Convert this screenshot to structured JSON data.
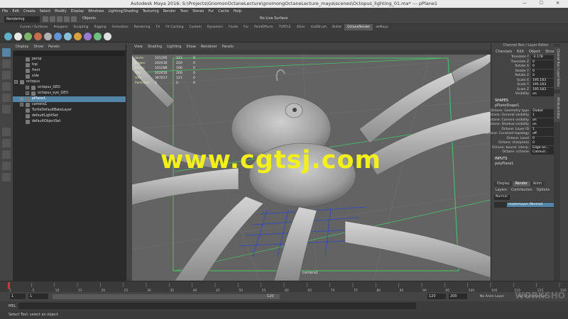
{
  "window": {
    "title": "Autodesk Maya 2016: S:\\Projects\\GnomonOctaneLecture\\gnomongOctaneLecture_maya\\scenes\\Octopus_lighting_01.ma*   ---   pPlane1",
    "controls": "—  ☐  ✕"
  },
  "menubar": [
    "File",
    "Edit",
    "Create",
    "Select",
    "Modify",
    "Display",
    "Windows",
    "Lighting/Shading",
    "Texturing",
    "Render",
    "Toon",
    "Stereo",
    "Fur",
    "Cache",
    "Help"
  ],
  "statusline": {
    "mode": "Rendering",
    "objects": "Objects",
    "live_surface": "No Live Surface"
  },
  "shelf_tabs": [
    "Curves / Surfaces",
    "Polygons",
    "Sculpting",
    "Rigging",
    "Animation",
    "Rendering",
    "FX",
    "FX Caching",
    "Custom",
    "Dynamics",
    "Fluids",
    "Fur",
    "PaintEffects",
    "TURTLE",
    "XGen",
    "GoZBrush",
    "Bullet",
    "OctaneRender",
    "ekMaya"
  ],
  "shelf_active": "OctaneRender",
  "shelf_icon_colors": [
    "#5fb0c8",
    "#e8e8e8",
    "#7fb56a",
    "#c86b4b",
    "#b0b0b0",
    "#5f94d6",
    "#88c0d8",
    "#d8a040",
    "#9a7ad0",
    "#70c080",
    "#e0e0e0"
  ],
  "outliner": {
    "menu": [
      "Display",
      "Show",
      "Panels"
    ],
    "items": [
      {
        "label": "persp",
        "indent": 1,
        "expander": false,
        "selected": false
      },
      {
        "label": "top",
        "indent": 1,
        "expander": false,
        "selected": false
      },
      {
        "label": "front",
        "indent": 1,
        "expander": false,
        "selected": false
      },
      {
        "label": "side",
        "indent": 1,
        "expander": false,
        "selected": false
      },
      {
        "label": "octopus",
        "indent": 0,
        "expander": true,
        "selected": false
      },
      {
        "label": "octopus_GEO",
        "indent": 2,
        "expander": true,
        "selected": false
      },
      {
        "label": "octopus_eye_GEO",
        "indent": 2,
        "expander": true,
        "selected": false
      },
      {
        "label": "pPlane1",
        "indent": 1,
        "expander": true,
        "selected": true
      },
      {
        "label": "camera1",
        "indent": 1,
        "expander": true,
        "selected": false
      },
      {
        "label": "TurtleDefaultBakeLayer",
        "indent": 1,
        "expander": false,
        "selected": false
      },
      {
        "label": "defaultLightSet",
        "indent": 1,
        "expander": false,
        "selected": false
      },
      {
        "label": "defaultObjectSet",
        "indent": 1,
        "expander": false,
        "selected": false
      }
    ]
  },
  "viewport": {
    "menu": [
      "View",
      "Shading",
      "Lighting",
      "Show",
      "Renderer",
      "Panels"
    ],
    "stats": [
      {
        "label": "Verts:",
        "a": "101295",
        "b": "121",
        "c": "0"
      },
      {
        "label": "Edges:",
        "a": "202436",
        "b": "220",
        "c": "0"
      },
      {
        "label": "Faces:",
        "a": "101288",
        "b": "100",
        "c": "0"
      },
      {
        "label": "Tris:",
        "a": "202416",
        "b": "200",
        "c": "0"
      },
      {
        "label": "UVs:",
        "a": "367017",
        "b": "121",
        "c": "0"
      },
      {
        "label": "Particles:",
        "a": "0",
        "b": "0",
        "c": "0"
      }
    ],
    "camera_label": "camera1"
  },
  "watermark": "www.cgtsj.com",
  "channel_box": {
    "title": "Channel Box / Layer Editor",
    "menu": [
      "Channels",
      "Edit",
      "Object",
      "Show"
    ],
    "attributes": [
      {
        "name": "Translate Y",
        "value": "-2.178"
      },
      {
        "name": "Translate Z",
        "value": "0"
      },
      {
        "name": "Rotate X",
        "value": "0"
      },
      {
        "name": "Rotate Y",
        "value": "0"
      },
      {
        "name": "Rotate Z",
        "value": "0"
      },
      {
        "name": "Scale X",
        "value": "195.183"
      },
      {
        "name": "Scale Y",
        "value": "195.183"
      },
      {
        "name": "Scale Z",
        "value": "195.183"
      },
      {
        "name": "Visibility",
        "value": "on"
      }
    ],
    "shapes_header": "SHAPES",
    "shape_name": "pPlaneShape1",
    "shape_attributes": [
      {
        "name": "Octane: Geometry type",
        "value": "Global"
      },
      {
        "name": "Octane: General visibility",
        "value": "1"
      },
      {
        "name": "Octane: Camera visibility",
        "value": "on"
      },
      {
        "name": "Octane: Shadow visibility",
        "value": "on"
      },
      {
        "name": "Octane: Layer ID",
        "value": "1"
      },
      {
        "name": "Octane: Constant topology",
        "value": "off"
      },
      {
        "name": "Octane: Level",
        "value": "0"
      },
      {
        "name": "Octane: sharpness",
        "value": "0"
      },
      {
        "name": "Octane: bound. interp.",
        "value": "Edge an..."
      },
      {
        "name": "Octane: scheme",
        "value": "Catmull..."
      }
    ],
    "inputs_header": "INPUTS",
    "input_name": "polyPlane1",
    "side_tabs": [
      "Channel Box / Layer Editor",
      "Attribute Editor"
    ]
  },
  "layer_editor": {
    "tabs": [
      "Display",
      "Render",
      "Anim"
    ],
    "active_tab": "Render",
    "menu": [
      "Layers",
      "Contribution",
      "Options"
    ],
    "blend": "Normal",
    "layer_name": "masterLayer (Normal)"
  },
  "time_slider": {
    "ticks": [
      "1",
      "5",
      "10",
      "15",
      "20",
      "25",
      "30",
      "35",
      "40",
      "45",
      "50",
      "55",
      "60",
      "65",
      "70",
      "75",
      "80",
      "85",
      "90",
      "95",
      "100",
      "105",
      "110",
      "115",
      "120"
    ],
    "current_frame": "1"
  },
  "range": {
    "start": "1",
    "inner_start": "1",
    "inner_end": "120",
    "end": "120",
    "max": "200",
    "anim_layer": "No Anim Layer",
    "char_set": "No Character Set"
  },
  "command_line": {
    "label": "MEL"
  },
  "help_line": "Select Tool: select an object",
  "corner_logo": "WORKSHO"
}
